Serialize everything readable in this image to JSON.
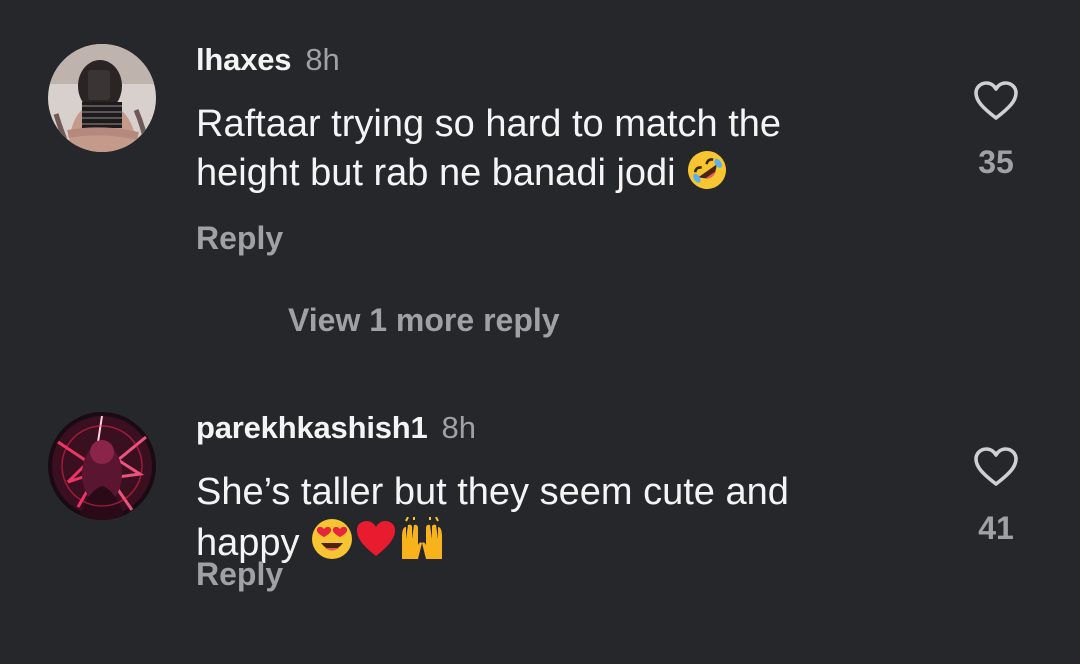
{
  "comments": [
    {
      "username": "lhaxes",
      "time": "8h",
      "text_lines": [
        "Raftaar trying so hard to match the",
        "height but rab ne banadi jodi"
      ],
      "emojis": [
        "rolling-on-floor-laughing"
      ],
      "likes": "35",
      "reply_label": "Reply"
    },
    {
      "username": "parekhkashish1",
      "time": "8h",
      "text_lines": [
        "She’s taller but they seem cute and",
        "happy"
      ],
      "emojis": [
        "heart-eyes",
        "red-heart",
        "raising-hands"
      ],
      "likes": "41",
      "reply_label": "Reply"
    }
  ],
  "view_more_replies": "View 1 more reply",
  "colors": {
    "background": "#26272b",
    "primary_text": "#f4f4f4",
    "secondary_text": "#a0a1a6"
  },
  "icons": {
    "like": "heart-outline-icon"
  }
}
